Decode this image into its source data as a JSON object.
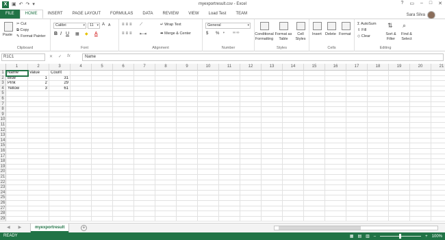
{
  "window": {
    "title": "myexportresult.csv - Excel",
    "app_logo": "X",
    "qat_icons": [
      "save-icon",
      "undo-icon",
      "redo-icon",
      "customize-icon"
    ],
    "controls": [
      "?",
      "▭",
      "–",
      "□",
      "✕"
    ]
  },
  "tabs": {
    "items": [
      "FILE",
      "HOME",
      "INSERT",
      "PAGE LAYOUT",
      "FORMULAS",
      "DATA",
      "REVIEW",
      "VIEW",
      "Load Test",
      "TEAM"
    ],
    "active": "HOME"
  },
  "user": {
    "name": "Sara Silva"
  },
  "ribbon": {
    "clipboard": {
      "paste": "Paste",
      "cut": "Cut",
      "copy": "Copy",
      "format_painter": "Format Painter",
      "label": "Clipboard"
    },
    "font": {
      "family": "Calibri",
      "size": "11",
      "label": "Font",
      "bold": "B",
      "italic": "I",
      "underline": "U",
      "grow": "A",
      "shrink": "A",
      "font_color": "A"
    },
    "alignment": {
      "wrap": "Wrap Text",
      "merge": "Merge & Center",
      "label": "Alignment"
    },
    "number": {
      "format": "General",
      "currency": "$",
      "percent": "%",
      "comma": "❜",
      "label": "Number"
    },
    "styles": {
      "conditional": "Conditional Formatting",
      "format_table": "Format as Table",
      "cell_styles": "Cell Styles",
      "label": "Styles"
    },
    "cells": {
      "insert": "Insert",
      "delete": "Delete",
      "format": "Format",
      "label": "Cells"
    },
    "editing": {
      "autosum": "AutoSum",
      "fill": "Fill",
      "clear": "Clear",
      "sort": "Sort & Filter",
      "find": "Find & Select",
      "label": "Editing"
    }
  },
  "formula_bar": {
    "name_box": "R1C1",
    "content": "Name",
    "cancel": "✕",
    "enter": "✓",
    "fx": "fx"
  },
  "sheet": {
    "columns": [
      "1",
      "2",
      "3",
      "4",
      "5",
      "6",
      "7",
      "8",
      "9",
      "10",
      "11",
      "12",
      "13",
      "14",
      "15",
      "16",
      "17",
      "18",
      "19",
      "20",
      "21"
    ],
    "rows": [
      "1",
      "2",
      "3",
      "4",
      "5",
      "6",
      "7",
      "8",
      "9",
      "10",
      "11",
      "12",
      "13",
      "14",
      "15",
      "16",
      "17",
      "18",
      "19",
      "20",
      "21",
      "22",
      "23",
      "24",
      "25",
      "26",
      "27",
      "28",
      "29"
    ],
    "data": [
      [
        "Name",
        "Value",
        "Count"
      ],
      [
        "Blue",
        "1",
        "31"
      ],
      [
        "Pink",
        "2",
        "29"
      ],
      [
        "Yellow",
        "3",
        "61"
      ]
    ],
    "tab_name": "myexportresult"
  },
  "status": {
    "ready": "READY",
    "zoom": "100%"
  }
}
